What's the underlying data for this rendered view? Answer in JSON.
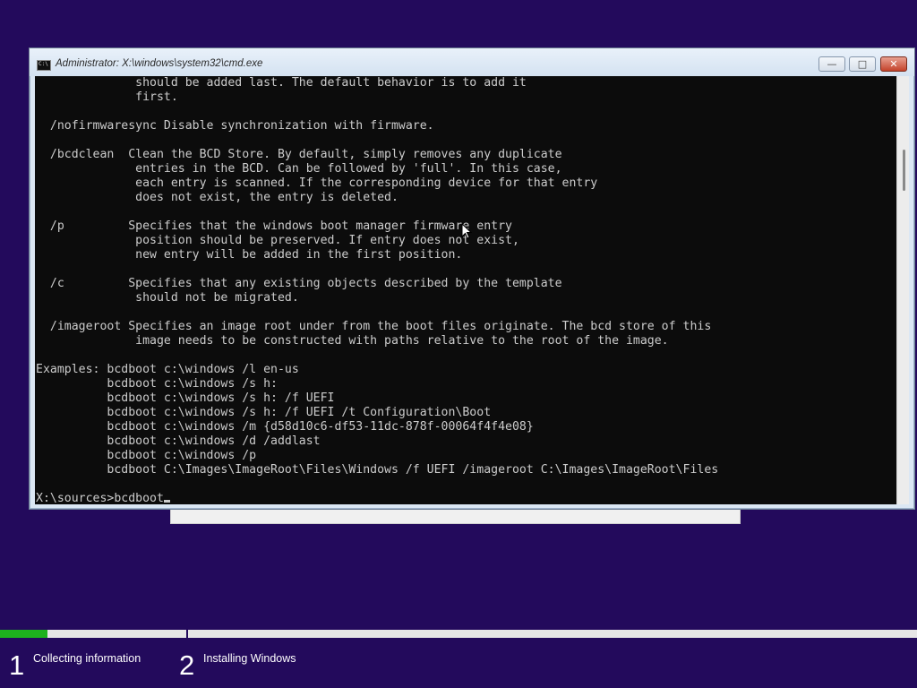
{
  "cmd_window": {
    "title": "Administrator: X:\\windows\\system32\\cmd.exe",
    "icon": "cmd-icon",
    "icon_glyph": "C:\\",
    "controls": {
      "minimize_glyph": "—",
      "maximize_glyph": "□",
      "close_glyph": "✕"
    },
    "output_lines": [
      "              should be added last. The default behavior is to add it",
      "              first.",
      "",
      "  /nofirmwaresync Disable synchronization with firmware.",
      "",
      "  /bcdclean  Clean the BCD Store. By default, simply removes any duplicate",
      "              entries in the BCD. Can be followed by 'full'. In this case,",
      "              each entry is scanned. If the corresponding device for that entry",
      "              does not exist, the entry is deleted.",
      "",
      "  /p         Specifies that the windows boot manager firmware entry",
      "              position should be preserved. If entry does not exist,",
      "              new entry will be added in the first position.",
      "",
      "  /c         Specifies that any existing objects described by the template",
      "              should not be migrated.",
      "",
      "  /imageroot Specifies an image root under from the boot files originate. The bcd store of this",
      "              image needs to be constructed with paths relative to the root of the image.",
      "",
      "Examples: bcdboot c:\\windows /l en-us",
      "          bcdboot c:\\windows /s h:",
      "          bcdboot c:\\windows /s h: /f UEFI",
      "          bcdboot c:\\windows /s h: /f UEFI /t Configuration\\Boot",
      "          bcdboot c:\\windows /m {d58d10c6-df53-11dc-878f-00064f4f4e08}",
      "          bcdboot c:\\windows /d /addlast",
      "          bcdboot c:\\windows /p",
      "          bcdboot C:\\Images\\ImageRoot\\Files\\Windows /f UEFI /imageroot C:\\Images\\ImageRoot\\Files",
      ""
    ],
    "prompt": "X:\\sources>",
    "input_value": "bcdboot"
  },
  "setup_progress": {
    "progress_fraction": 0.052,
    "steps": [
      {
        "number": "1",
        "label": "Collecting information"
      },
      {
        "number": "2",
        "label": "Installing Windows"
      }
    ]
  },
  "colors": {
    "background": "#230a5c",
    "console_bg": "#0c0c0c",
    "console_text": "#cccccc",
    "progress_fill": "#1db11d"
  }
}
